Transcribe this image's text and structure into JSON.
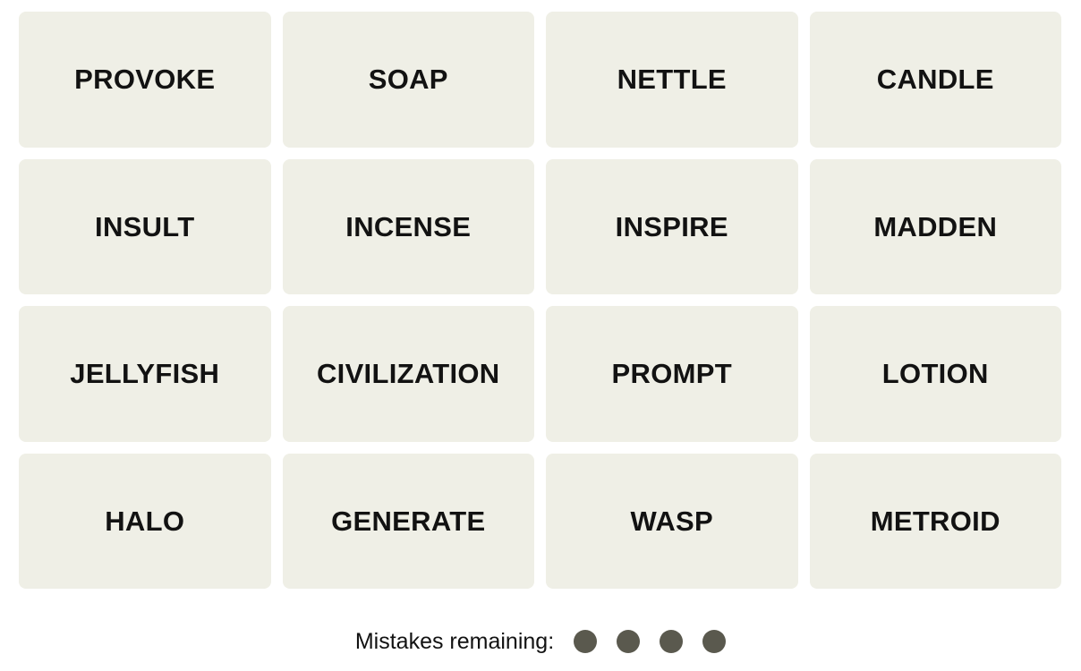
{
  "game": {
    "name": "connections-word-grid",
    "tile_background_color": "#EFEFE6",
    "tile_text_color": "#121212",
    "page_background_color": "#FFFFFF",
    "grid_columns": 4,
    "grid_rows": 4
  },
  "grid": {
    "rows": [
      {
        "tiles": [
          {
            "word": "PROVOKE"
          },
          {
            "word": "SOAP"
          },
          {
            "word": "NETTLE"
          },
          {
            "word": "CANDLE"
          }
        ]
      },
      {
        "tiles": [
          {
            "word": "INSULT"
          },
          {
            "word": "INCENSE"
          },
          {
            "word": "INSPIRE"
          },
          {
            "word": "MADDEN"
          }
        ]
      },
      {
        "tiles": [
          {
            "word": "JELLYFISH"
          },
          {
            "word": "CIVILIZATION"
          },
          {
            "word": "PROMPT"
          },
          {
            "word": "LOTION"
          }
        ]
      },
      {
        "tiles": [
          {
            "word": "HALO"
          },
          {
            "word": "GENERATE"
          },
          {
            "word": "WASP"
          },
          {
            "word": "METROID"
          }
        ]
      }
    ]
  },
  "mistakes": {
    "label": "Mistakes remaining:",
    "remaining": 4,
    "dot_color": "#5A594E",
    "dots": [
      {
        "name": "mistake-dot-1"
      },
      {
        "name": "mistake-dot-2"
      },
      {
        "name": "mistake-dot-3"
      },
      {
        "name": "mistake-dot-4"
      }
    ]
  }
}
